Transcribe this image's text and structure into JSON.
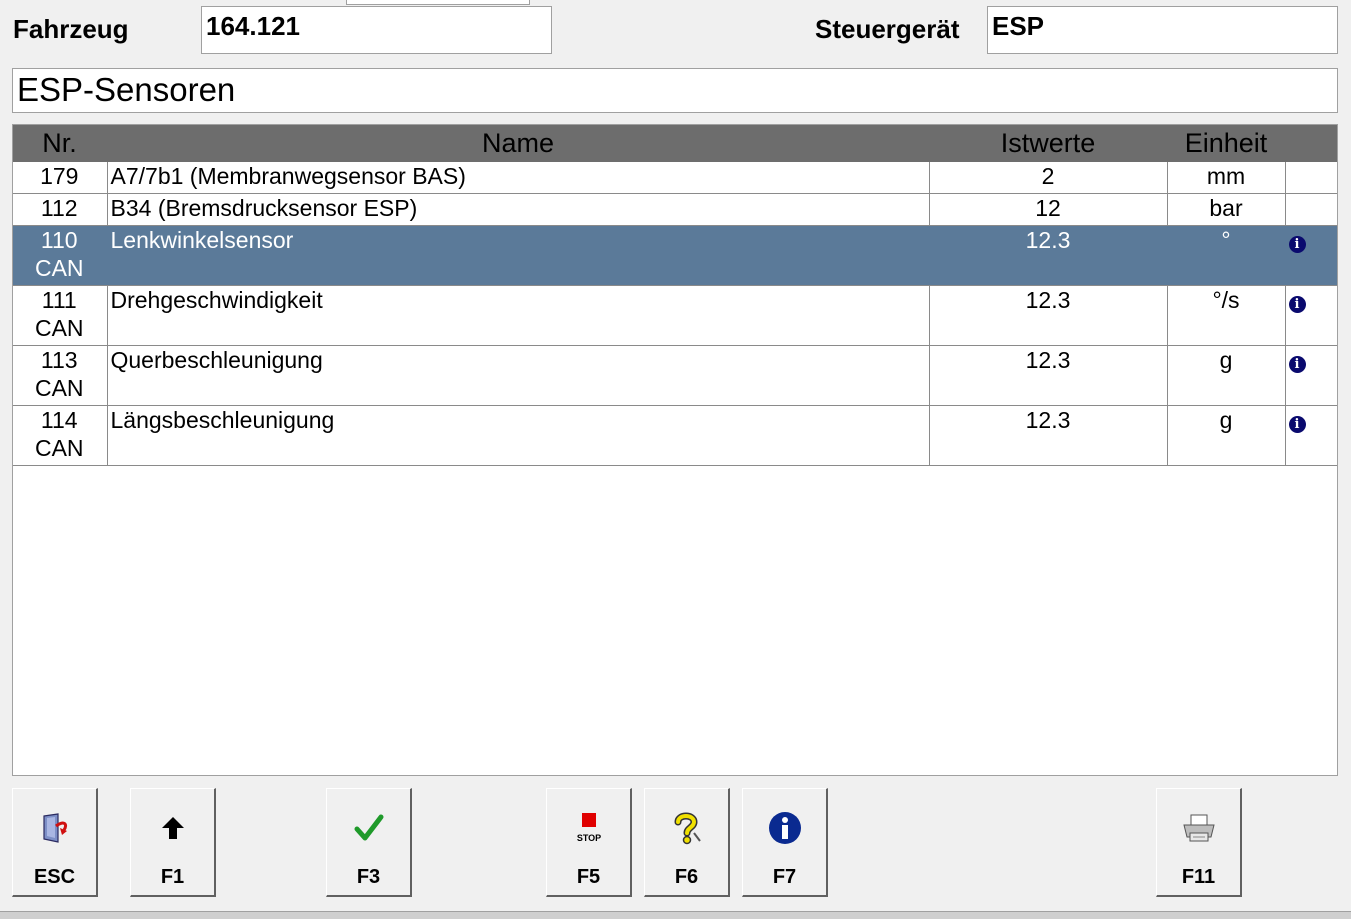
{
  "header": {
    "vehicle_label": "Fahrzeug",
    "vehicle_value": "164.121",
    "ecu_label": "Steuergerät",
    "ecu_value": "ESP"
  },
  "title": "ESP-Sensoren",
  "table": {
    "columns": [
      "Nr.",
      "Name",
      "Istwerte",
      "Einheit"
    ],
    "rows": [
      {
        "nr": "179",
        "sub": "",
        "name": "A7/7b1 (Membranwegsensor BAS)",
        "value": "2",
        "unit": "mm",
        "info": false,
        "selected": false
      },
      {
        "nr": "112",
        "sub": "",
        "name": "B34 (Bremsdrucksensor ESP)",
        "value": "12",
        "unit": "bar",
        "info": false,
        "selected": false
      },
      {
        "nr": "110",
        "sub": "CAN",
        "name": "Lenkwinkelsensor",
        "value": "12.3",
        "unit": "°",
        "info": true,
        "selected": true
      },
      {
        "nr": "111",
        "sub": "CAN",
        "name": "Drehgeschwindigkeit",
        "value": "12.3",
        "unit": "°/s",
        "info": true,
        "selected": false
      },
      {
        "nr": "113",
        "sub": "CAN",
        "name": "Querbeschleunigung",
        "value": "12.3",
        "unit": "g",
        "info": true,
        "selected": false
      },
      {
        "nr": "114",
        "sub": "CAN",
        "name": "Längsbeschleunigung",
        "value": "12.3",
        "unit": "g",
        "info": true,
        "selected": false
      }
    ],
    "info_glyph": "i"
  },
  "function_keys": [
    {
      "key": "ESC",
      "icon": "exit-door-icon"
    },
    {
      "key": "F1",
      "icon": "arrow-up-icon"
    },
    {
      "key": "F3",
      "icon": "checkmark-icon"
    },
    {
      "key": "F5",
      "icon": "stop-icon",
      "icon_text": "STOP"
    },
    {
      "key": "F6",
      "icon": "help-question-icon"
    },
    {
      "key": "F7",
      "icon": "info-icon"
    },
    {
      "key": "F11",
      "icon": "printer-icon"
    }
  ],
  "colors": {
    "selection": "#5b7a99",
    "header_bg": "#6d6d6d",
    "info_icon": "#0a0a6e",
    "check": "#1f9a2a",
    "stop": "#e00000",
    "help": "#f0e000"
  }
}
